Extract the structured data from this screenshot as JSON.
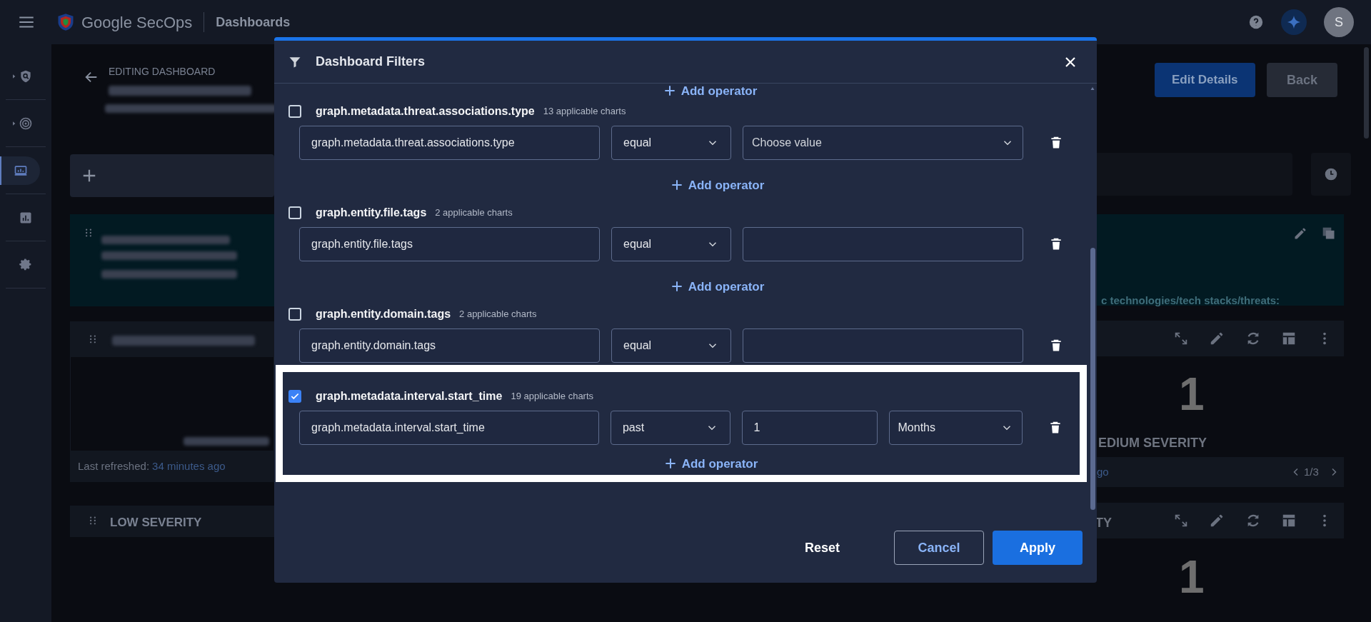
{
  "topbar": {
    "product": "Google SecOps",
    "section": "Dashboards",
    "avatar": "S"
  },
  "sidebar": {
    "items": [
      {
        "expandable": true,
        "selected": false
      },
      {
        "expandable": true,
        "selected": false
      },
      {
        "expandable": false,
        "selected": true
      },
      {
        "expandable": false,
        "selected": false
      },
      {
        "expandable": false,
        "selected": false
      }
    ]
  },
  "page": {
    "heading": "EDITING DASHBOARD",
    "buttons": [
      {
        "label": "Edit Details",
        "kind": "primary"
      },
      {
        "label": "Back",
        "kind": "secondary"
      }
    ]
  },
  "background": {
    "refreshed_label": "Last refreshed:",
    "refreshed_time": "34 minutes ago",
    "low_title": "LOW SEVERITY",
    "teal_text": "c technologies/tech stacks/threats:",
    "medium_value": "1",
    "medium_title": "EDIUM SEVERITY",
    "medium_footer": "go",
    "pager": "1/3",
    "low_value": "1",
    "low_title_tail": "TY"
  },
  "dialog": {
    "title": "Dashboard Filters",
    "top_add_operator": "Add operator",
    "filters": [
      {
        "name": "graph.metadata.threat.associations.type",
        "count": "13 applicable charts",
        "checked": false,
        "highlighted": false,
        "field": "graph.metadata.threat.associations.type",
        "operator": "equal",
        "kind": "select",
        "placeholder": "Choose value",
        "add_operator": "Add operator"
      },
      {
        "name": "graph.entity.file.tags",
        "count": "2 applicable charts",
        "checked": false,
        "highlighted": false,
        "field": "graph.entity.file.tags",
        "operator": "equal",
        "kind": "text",
        "add_operator": "Add operator"
      },
      {
        "name": "graph.entity.domain.tags",
        "count": "2 applicable charts",
        "checked": false,
        "highlighted": false,
        "field": "graph.entity.domain.tags",
        "operator": "equal",
        "kind": "text"
      },
      {
        "name": "graph.metadata.interval.start_time",
        "count": "19 applicable charts",
        "checked": true,
        "highlighted": true,
        "field": "graph.metadata.interval.start_time",
        "operator": "past",
        "kind": "text",
        "value": "1",
        "unit": "Months",
        "add_operator": "Add operator"
      }
    ],
    "footer": {
      "reset": "Reset",
      "cancel": "Cancel",
      "apply": "Apply"
    }
  }
}
